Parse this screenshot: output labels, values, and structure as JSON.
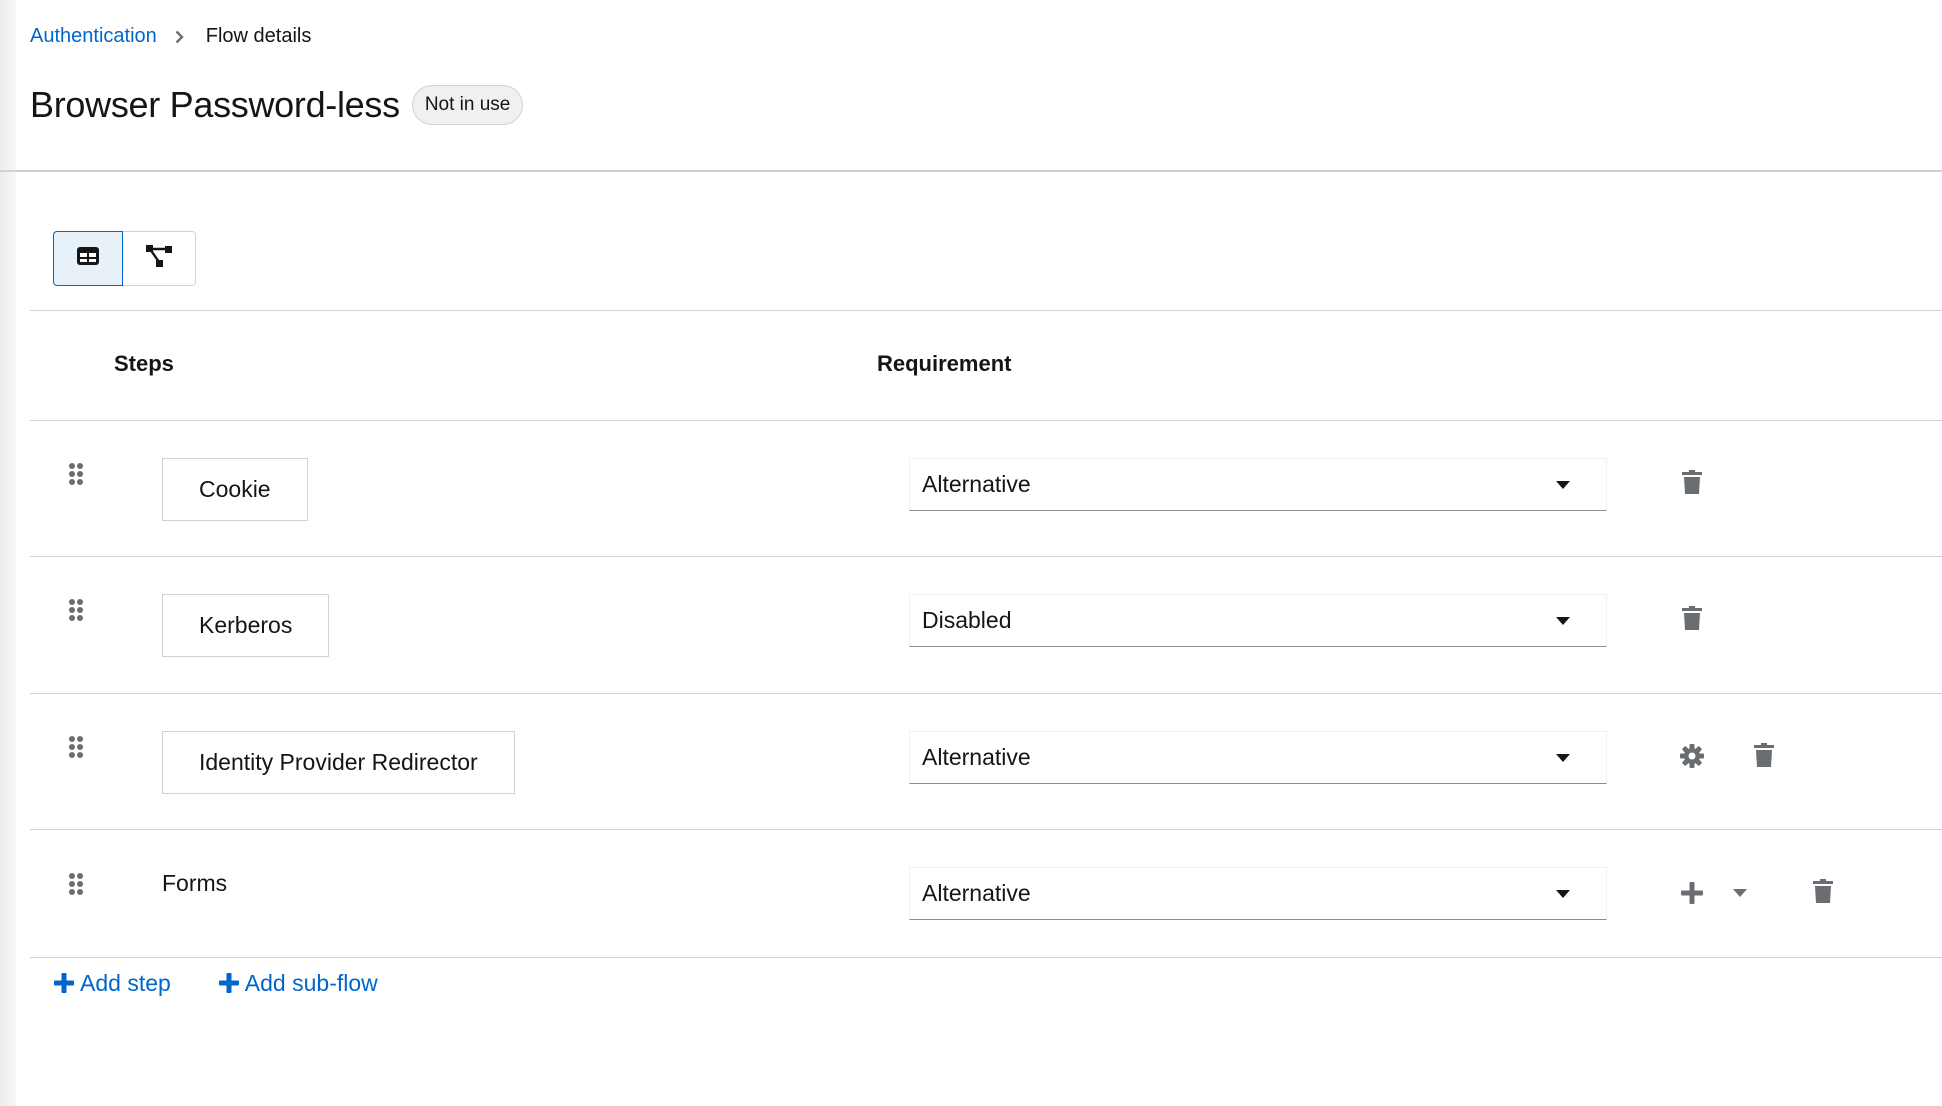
{
  "breadcrumb": {
    "parent": "Authentication",
    "current": "Flow details"
  },
  "header": {
    "title": "Browser Password-less",
    "status_badge": "Not in use"
  },
  "view_toggle": {
    "options": [
      {
        "name": "table-view",
        "icon": "table-icon",
        "selected": true
      },
      {
        "name": "diagram-view",
        "icon": "topology-icon",
        "selected": false
      }
    ]
  },
  "table": {
    "columns": [
      "Steps",
      "Requirement"
    ],
    "rows": [
      {
        "step": "Cookie",
        "type": "execution",
        "requirement": "Alternative",
        "actions": [
          "delete"
        ]
      },
      {
        "step": "Kerberos",
        "type": "execution",
        "requirement": "Disabled",
        "actions": [
          "delete"
        ]
      },
      {
        "step": "Identity Provider Redirector",
        "type": "execution",
        "requirement": "Alternative",
        "actions": [
          "settings",
          "delete"
        ]
      },
      {
        "step": "Forms",
        "type": "sub-flow",
        "requirement": "Alternative",
        "actions": [
          "add",
          "add-dropdown",
          "delete"
        ]
      }
    ]
  },
  "footer": {
    "add_step": "Add step",
    "add_subflow": "Add sub-flow"
  },
  "colors": {
    "link": "#0066cc",
    "icon": "#6a6e73",
    "border": "#d2d2d2",
    "selected_toggle_bg": "#e7f1fa"
  }
}
